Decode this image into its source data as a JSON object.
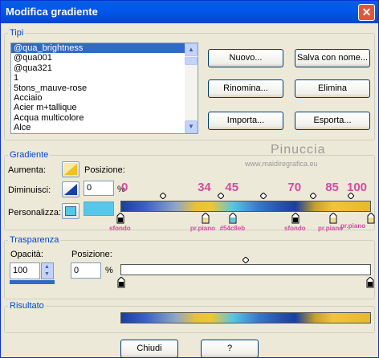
{
  "window": {
    "title": "Modifica gradiente",
    "close_glyph": "✕"
  },
  "tipi": {
    "legend": "Tipi",
    "list_items": [
      "@qua_brightness",
      "@qua001",
      "@qua321",
      "1",
      "5tons_mauve-rose",
      "Acciaio",
      "Acier m+tallique",
      "Acqua multicolore",
      "Alce"
    ],
    "selected_index": 0,
    "buttons": {
      "new": "Nuovo...",
      "save_as": "Salva con nome...",
      "rename": "Rinomina...",
      "delete": "Elimina",
      "import": "Importa...",
      "export": "Esporta..."
    }
  },
  "gradiente": {
    "legend": "Gradiente",
    "aumenta": "Aumenta:",
    "posizione": "Posizione:",
    "diminuisci": "Diminuisci:",
    "position_value": "0",
    "percent": "%",
    "personalizza": "Personalizza:",
    "custom_color": "#54c8eb",
    "stop_positions": [
      0,
      34,
      45,
      70,
      85,
      100
    ],
    "stop_colors": [
      "#000000",
      "#f5d98a",
      "#54c8eb",
      "#000000",
      "#f5d98a",
      "#f5d98a"
    ],
    "midpoints": [
      17,
      40,
      57,
      77,
      92
    ],
    "annotations": {
      "numbers": [
        "0",
        "34",
        "45",
        "70",
        "85",
        "100"
      ],
      "labels": [
        "sfondo",
        "pr.piano",
        "#54c8eb",
        "sfondo",
        "pr.piano",
        "pr.piano"
      ]
    }
  },
  "trasparenza": {
    "legend": "Trasparenza",
    "opacita_label": "Opacità:",
    "opacita_value": "100",
    "posizione_label": "Posizione:",
    "posizione_value": "0",
    "percent": "%"
  },
  "risultato": {
    "legend": "Risultato"
  },
  "footer": {
    "close": "Chiudi",
    "help": "?"
  },
  "watermark": {
    "name": "Pinuccia",
    "url": "www.maidiregrafica.eu"
  }
}
